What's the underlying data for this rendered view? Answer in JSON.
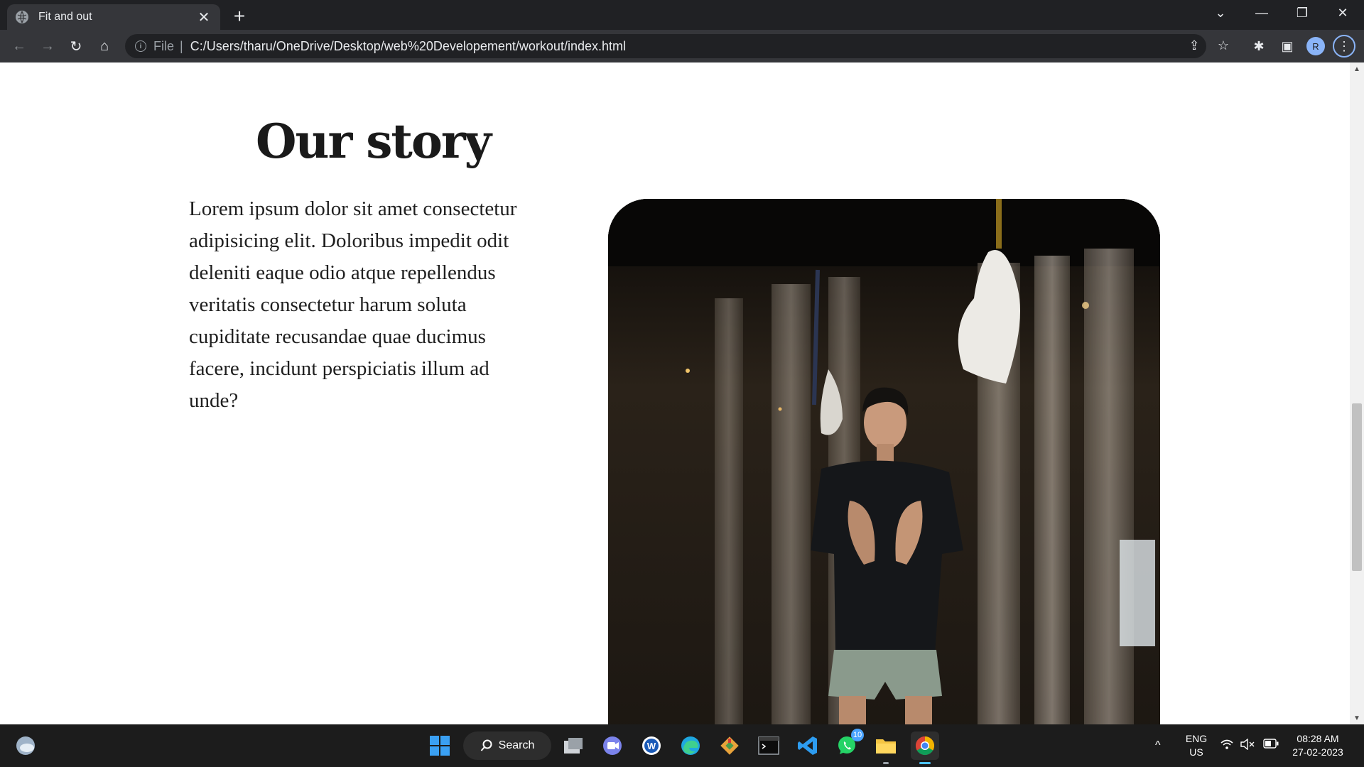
{
  "browser": {
    "tab": {
      "title": "Fit and out",
      "close": "✕"
    },
    "new_tab": "+",
    "window_controls": {
      "tabsearch": "⌄",
      "minimize": "—",
      "restore": "❐",
      "close": "✕"
    },
    "toolbar": {
      "back": "←",
      "forward": "→",
      "reload": "↻",
      "home": "⌂",
      "address": {
        "info": "i",
        "scheme_chip": "File",
        "separator": "|",
        "url": "C:/Users/tharu/OneDrive/Desktop/web%20Developement/workout/index.html"
      },
      "share": "⇪",
      "bookmark": "☆",
      "extensions": "✱",
      "sidepanel": "▣",
      "profile_initial": "R",
      "menu": "⋮"
    }
  },
  "page": {
    "title": "Our story",
    "body": "Lorem ipsum dolor sit amet consectetur adipisicing elit. Doloribus impedit odit deleniti eaque odio atque repellendus veritatis consectetur harum soluta cupiditate recusandae quae ducimus facere, incidunt perspiciatis illum ad unde?"
  },
  "scrollbar": {
    "up": "▲",
    "down": "▼",
    "scroll_position": 0.7
  },
  "taskbar": {
    "search_label": "Search",
    "whatsapp_badge": "10",
    "tray": {
      "chevron": "^",
      "lang_top": "ENG",
      "lang_bottom": "US",
      "time": "08:28 AM",
      "date": "27-02-2023"
    }
  },
  "colors": {
    "chrome_dark": "#202124",
    "chrome_toolbar": "#35363a",
    "taskbar": "#1c1c1c",
    "accent": "#8ab4f8"
  }
}
